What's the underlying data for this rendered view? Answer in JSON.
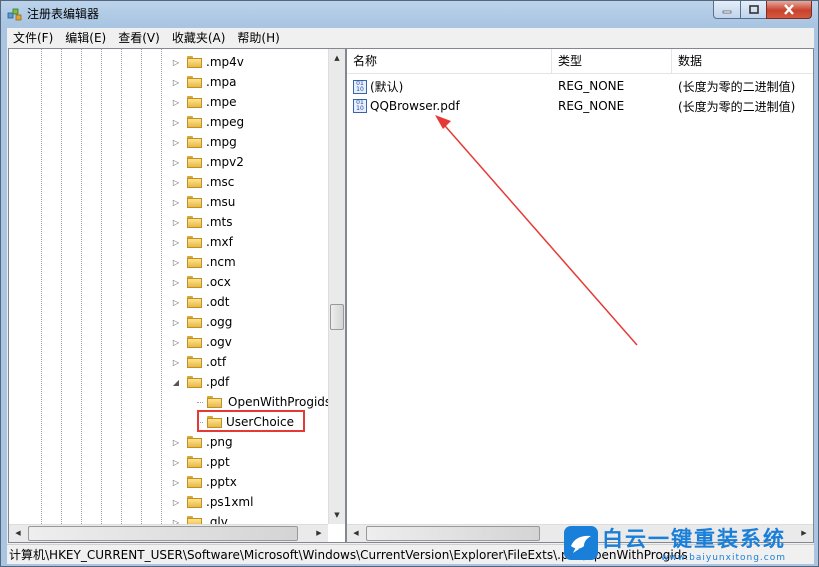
{
  "window": {
    "title": "注册表编辑器"
  },
  "menu": [
    "文件(F)",
    "编辑(E)",
    "查看(V)",
    "收藏夹(A)",
    "帮助(H)"
  ],
  "tree": {
    "items": [
      {
        "label": ".mp4v",
        "expander": "right"
      },
      {
        "label": ".mpa",
        "expander": "right"
      },
      {
        "label": ".mpe",
        "expander": "right"
      },
      {
        "label": ".mpeg",
        "expander": "right"
      },
      {
        "label": ".mpg",
        "expander": "right"
      },
      {
        "label": ".mpv2",
        "expander": "right"
      },
      {
        "label": ".msc",
        "expander": "right"
      },
      {
        "label": ".msu",
        "expander": "right"
      },
      {
        "label": ".mts",
        "expander": "right"
      },
      {
        "label": ".mxf",
        "expander": "right"
      },
      {
        "label": ".ncm",
        "expander": "right"
      },
      {
        "label": ".ocx",
        "expander": "right"
      },
      {
        "label": ".odt",
        "expander": "right"
      },
      {
        "label": ".ogg",
        "expander": "right"
      },
      {
        "label": ".ogv",
        "expander": "right"
      },
      {
        "label": ".otf",
        "expander": "right"
      },
      {
        "label": ".pdf",
        "expander": "down"
      },
      {
        "label": "OpenWithProgids",
        "expander": "none",
        "child": true,
        "selected": true
      },
      {
        "label": "UserChoice",
        "expander": "none",
        "child": true,
        "highlighted": true
      },
      {
        "label": ".png",
        "expander": "right"
      },
      {
        "label": ".ppt",
        "expander": "right"
      },
      {
        "label": ".pptx",
        "expander": "right"
      },
      {
        "label": ".ps1xml",
        "expander": "right"
      },
      {
        "label": ".qlv",
        "expander": "right"
      }
    ]
  },
  "list": {
    "columns": [
      "名称",
      "类型",
      "数据"
    ],
    "rows": [
      {
        "name": "(默认)",
        "type": "REG_NONE",
        "data": "(长度为零的二进制值)"
      },
      {
        "name": "QQBrowser.pdf",
        "type": "REG_NONE",
        "data": "(长度为零的二进制值)"
      }
    ]
  },
  "statusbar": {
    "path": "计算机\\HKEY_CURRENT_USER\\Software\\Microsoft\\Windows\\CurrentVersion\\Explorer\\FileExts\\.pdf\\OpenWithProgids"
  },
  "watermark": {
    "main": "白云一键重装系统",
    "sub": "www.baiyunxitong.com"
  },
  "colors": {
    "annotation": "#e53935",
    "brand": "#1a7fd9"
  }
}
